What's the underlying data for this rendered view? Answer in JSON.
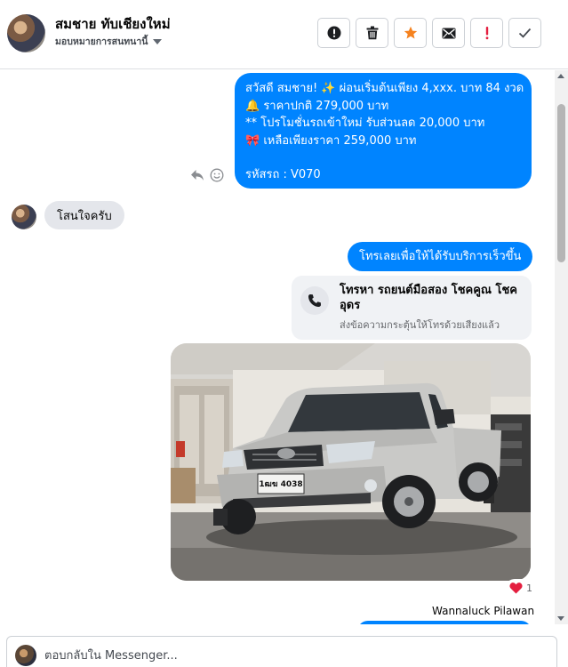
{
  "header": {
    "contact_name": "สมชาย ทับเชียงใหม่",
    "assign_label": "มอบหมายการสนทนานี้",
    "actions": [
      {
        "name": "report-button",
        "icon": "alert-circle-icon"
      },
      {
        "name": "delete-button",
        "icon": "trash-icon"
      },
      {
        "name": "star-button",
        "icon": "star-icon"
      },
      {
        "name": "mark-unread-button",
        "icon": "envelope-icon"
      },
      {
        "name": "spam-button",
        "icon": "exclamation-icon"
      },
      {
        "name": "done-button",
        "icon": "check-icon"
      }
    ]
  },
  "messages": {
    "promo_lines": [
      "สวัสดี สมชาย! ✨  ผ่อนเริ่มต้นเพียง 4,xxx. บาท 84 งวด",
      "🔔  ราคาปกติ 279,000 บาท",
      "** โปรโมชั่นรถเข้าใหม่ รับส่วนลด 20,000 บาท",
      "🎀  เหลือเพียงราคา 259,000 บาท"
    ],
    "promo_code": "รหัสรถ : V070",
    "incoming_text": "โสนใจครับ",
    "call_cta": "โทรเลยเพื่อให้ได้รับบริการเร็วขึ้น",
    "call_card_title": "โทรหา รถยนต์มือสอง โชคคูณ โชค อุดร",
    "call_card_subtitle": "ส่งข้อความกระตุ้นให้โทรด้วยเสียงแล้ว",
    "photo_plate": "1ฒฆ 4038",
    "reaction_count": "1",
    "sender_name": "Wannaluck Pilawan"
  },
  "composer": {
    "placeholder": "ตอบกลับใน Messenger..."
  },
  "colors": {
    "accent": "#0084ff",
    "bubble_in": "#e4e6eb",
    "star": "#f5821f",
    "danger": "#e41e3f"
  }
}
